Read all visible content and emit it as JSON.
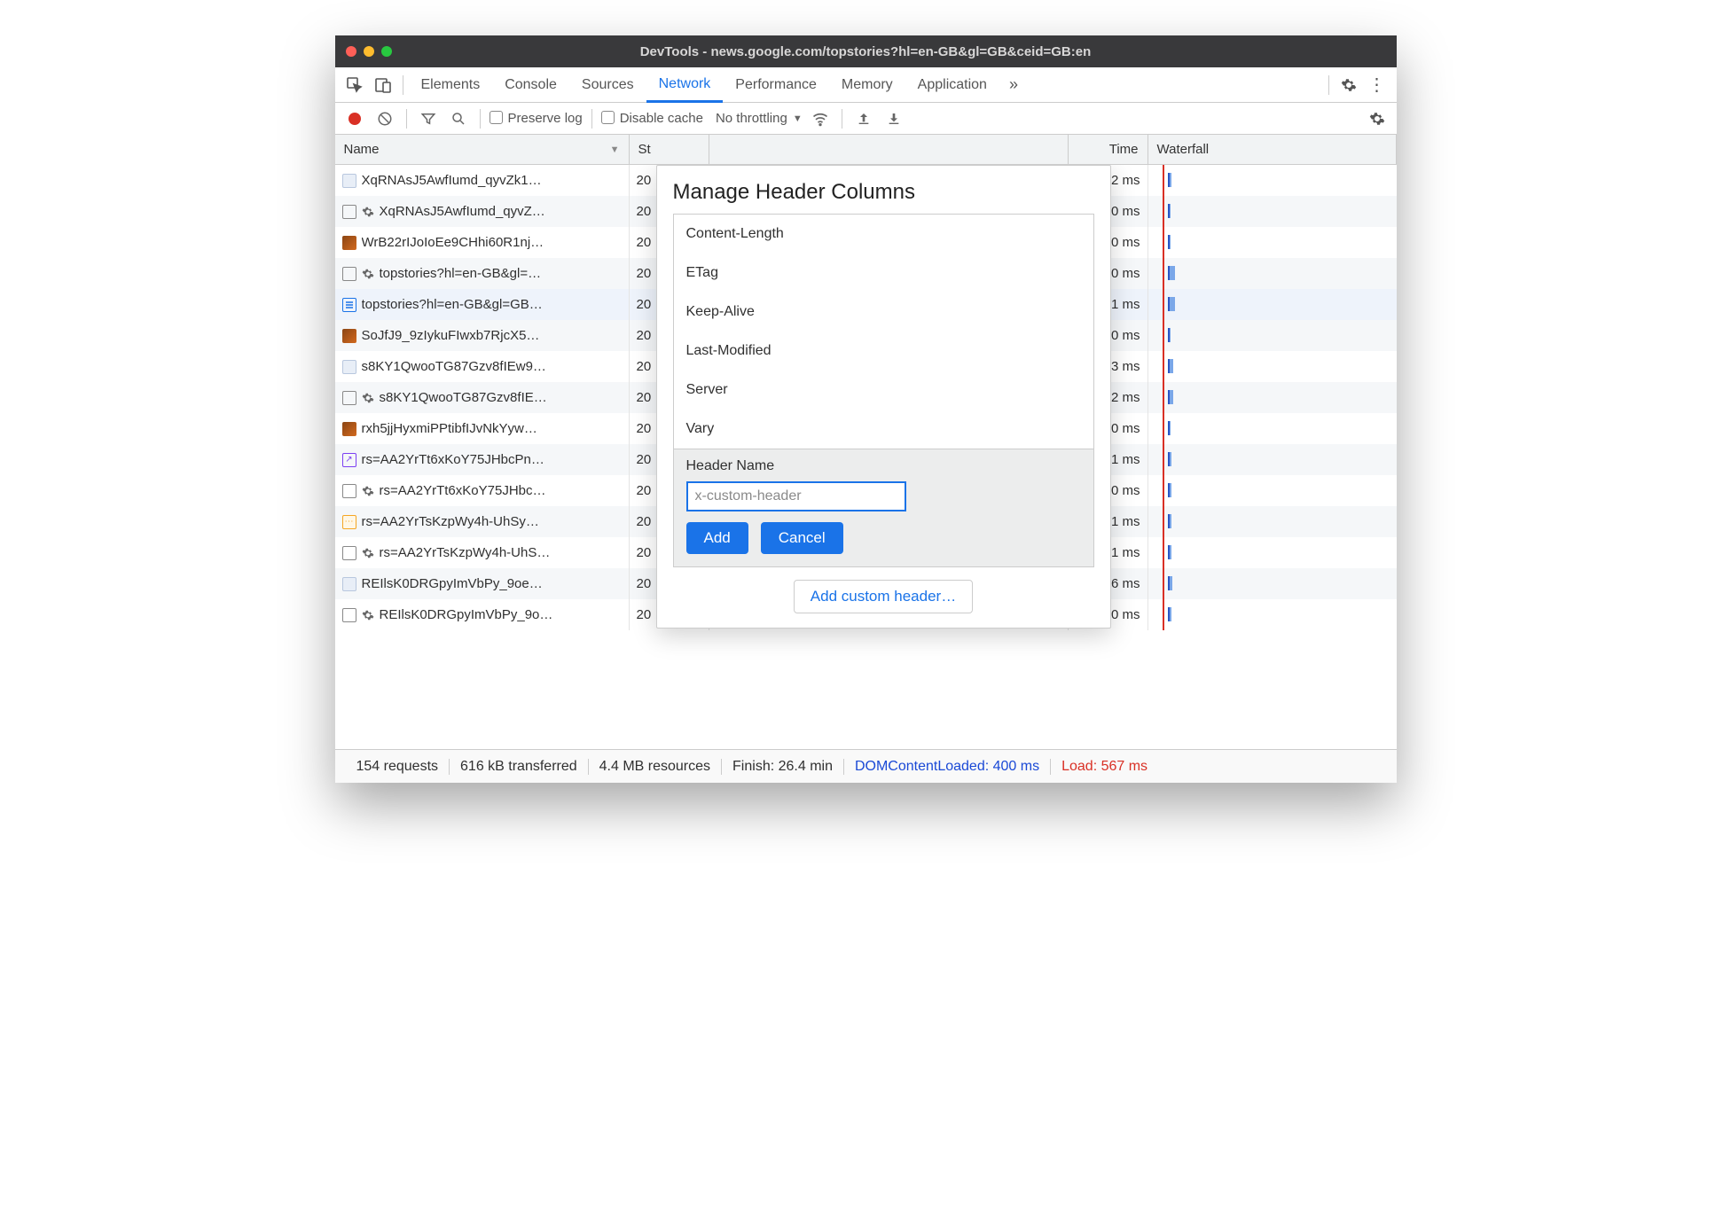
{
  "window": {
    "title": "DevTools - news.google.com/topstories?hl=en-GB&gl=GB&ceid=GB:en"
  },
  "tabs": {
    "items": [
      "Elements",
      "Console",
      "Sources",
      "Network",
      "Performance",
      "Memory",
      "Application"
    ],
    "active": 3
  },
  "toolbar": {
    "preserve_log": "Preserve log",
    "disable_cache": "Disable cache",
    "throttling": "No throttling"
  },
  "columns": {
    "name": "Name",
    "status_short": "St",
    "time_short": "Time",
    "waterfall": "Waterfall"
  },
  "rows": [
    {
      "icon": "img-chip",
      "name": "XqRNAsJ5AwfIumd_qyvZk1…",
      "status": "20",
      "time": "2 ms",
      "w": 4
    },
    {
      "icon": "gear",
      "name": "XqRNAsJ5AwfIumd_qyvZ…",
      "status": "20",
      "time": "0 ms",
      "w": 3
    },
    {
      "icon": "img",
      "name": "WrB22rIJoIoEe9CHhi60R1nj…",
      "status": "20",
      "time": "0 ms",
      "w": 3
    },
    {
      "icon": "gear",
      "name": "topstories?hl=en-GB&gl=…",
      "status": "20",
      "time": "330 ms",
      "w": 8
    },
    {
      "icon": "doc",
      "name": "topstories?hl=en-GB&gl=GB…",
      "status": "20",
      "time": "331 ms",
      "w": 8,
      "sel": true
    },
    {
      "icon": "img",
      "name": "SoJfJ9_9zIykuFIwxb7RjcX5…",
      "status": "20",
      "time": "0 ms",
      "w": 3
    },
    {
      "icon": "img-chip",
      "name": "s8KY1QwooTG87Gzv8fIEw9…",
      "status": "20",
      "time": "53 ms",
      "w": 6
    },
    {
      "icon": "gear",
      "name": "s8KY1QwooTG87Gzv8fIE…",
      "status": "20",
      "time": "52 ms",
      "w": 6
    },
    {
      "icon": "img",
      "name": "rxh5jjHyxmiPPtibfIJvNkYyw…",
      "status": "20",
      "time": "0 ms",
      "w": 3
    },
    {
      "icon": "script",
      "name": "rs=AA2YrTt6xKoY75JHbcPn…",
      "status": "20",
      "time": "1 ms",
      "w": 4
    },
    {
      "icon": "gear",
      "name": "rs=AA2YrTt6xKoY75JHbc…",
      "status": "20",
      "time": "0 ms",
      "w": 4
    },
    {
      "icon": "script2",
      "name": "rs=AA2YrTsKzpWy4h-UhSy…",
      "status": "20",
      "time": "1 ms",
      "w": 4
    },
    {
      "icon": "gear",
      "name": "rs=AA2YrTsKzpWy4h-UhS…",
      "status": "20",
      "time": "1 ms",
      "w": 4
    },
    {
      "icon": "img-chip",
      "name": "REIlsK0DRGpyImVbPy_9oe…",
      "status": "20",
      "time": "6 ms",
      "w": 5
    },
    {
      "icon": "gear",
      "name": "REIlsK0DRGpyImVbPy_9o…",
      "status": "20",
      "time": "0 ms",
      "w": 4
    }
  ],
  "modal": {
    "title": "Manage Header Columns",
    "headers": [
      "Content-Length",
      "ETag",
      "Keep-Alive",
      "Last-Modified",
      "Server",
      "Vary"
    ],
    "form_label": "Header Name",
    "placeholder": "x-custom-header",
    "add": "Add",
    "cancel": "Cancel",
    "add_custom": "Add custom header…"
  },
  "status": {
    "requests": "154 requests",
    "transferred": "616 kB transferred",
    "resources": "4.4 MB resources",
    "finish": "Finish: 26.4 min",
    "dcl": "DOMContentLoaded: 400 ms",
    "load": "Load: 567 ms"
  }
}
